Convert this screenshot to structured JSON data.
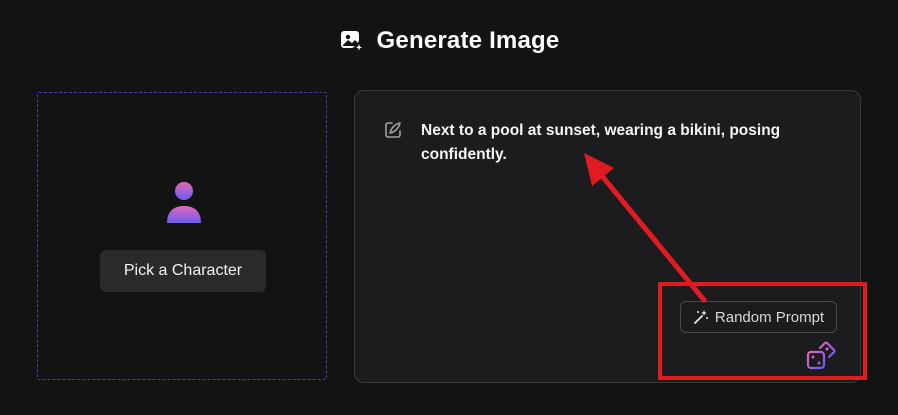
{
  "header": {
    "title": "Generate Image",
    "icon": "image-sparkle-icon"
  },
  "character": {
    "avatar_icon": "user-avatar-icon",
    "pick_label": "Pick a Character"
  },
  "prompt": {
    "edit_icon": "edit-pen-icon",
    "text": "Next to a pool at sunset, wearing a bikini, posing confidently.",
    "random_label": "Random Prompt",
    "random_icon": "magic-wand-icon",
    "dice_icon": "dice-icon"
  },
  "annotation": {
    "highlight_color": "#e11b22",
    "arrow_color": "#e11b22"
  },
  "colors": {
    "background": "#131314",
    "panel": "#1c1c1e",
    "dashed_border": "#4a3fb0",
    "accent_pink": "#e466b8",
    "accent_purple": "#6a5cf5"
  }
}
